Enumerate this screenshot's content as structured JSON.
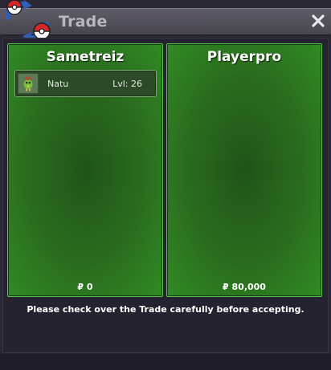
{
  "window": {
    "title": "Trade",
    "close_icon": "close-icon",
    "logo_icon": "trade-arrows-pokeball-icon"
  },
  "left_panel": {
    "trainer_name": "Sametreiz",
    "money": "₽ 0",
    "pokemon": [
      {
        "name": "Natu",
        "level": "Lvl: 26",
        "icon": "natu-sprite-icon"
      }
    ]
  },
  "right_panel": {
    "trainer_name": "Playerpro",
    "money": "₽ 80,000",
    "pokemon": []
  },
  "notice": "Please check over the Trade carefully before accepting.",
  "colors": {
    "panel_green": "#2a6d1e",
    "panel_border": "#5ac24a",
    "titlebar": "#55525c",
    "background": "#2b2836"
  }
}
